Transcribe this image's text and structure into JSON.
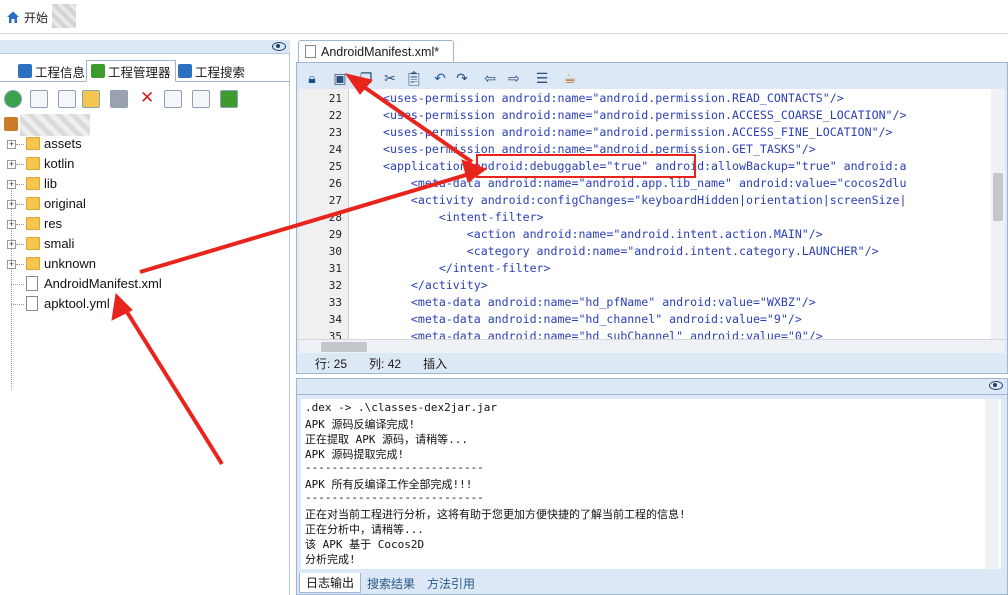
{
  "topbar": {
    "start_label": "开始"
  },
  "left_tabs": [
    {
      "label": "工程信息",
      "color": "#2d6fc1"
    },
    {
      "label": "工程管理器",
      "color": "#3d9a2c"
    },
    {
      "label": "工程搜索",
      "color": "#2d6fc1"
    }
  ],
  "tree": [
    {
      "label": "assets",
      "kind": "folder"
    },
    {
      "label": "kotlin",
      "kind": "folder"
    },
    {
      "label": "lib",
      "kind": "folder"
    },
    {
      "label": "original",
      "kind": "folder"
    },
    {
      "label": "res",
      "kind": "folder"
    },
    {
      "label": "smali",
      "kind": "folder"
    },
    {
      "label": "unknown",
      "kind": "folder"
    },
    {
      "label": "AndroidManifest.xml",
      "kind": "file"
    },
    {
      "label": "apktool.yml",
      "kind": "file"
    }
  ],
  "editor": {
    "tab_label": "AndroidManifest.xml*",
    "line_numbers": [
      "21",
      "22",
      "23",
      "24",
      "25",
      "26",
      "27",
      "28",
      "29",
      "30",
      "31",
      "32",
      "33",
      "34",
      "35"
    ],
    "lines": [
      "<uses-permission android:name=\"android.permission.READ_CONTACTS\"/>",
      "<uses-permission android:name=\"android.permission.ACCESS_COARSE_LOCATION\"/>",
      "<uses-permission android:name=\"android.permission.ACCESS_FINE_LOCATION\"/>",
      "<uses-permission android:name=\"android.permission.GET_TASKS\"/>",
      "<application android:debuggable=\"true\" android:allowBackup=\"true\" android:a",
      "    <meta-data android:name=\"android.app.lib_name\" android:value=\"cocos2dlu",
      "    <activity android:configChanges=\"keyboardHidden|orientation|screenSize|",
      "        <intent-filter>",
      "            <action android:name=\"android.intent.action.MAIN\"/>",
      "            <category android:name=\"android.intent.category.LAUNCHER\"/>",
      "        </intent-filter>",
      "    </activity>",
      "    <meta-data android:name=\"hd_pfName\" android:value=\"WXBZ\"/>",
      "    <meta-data android:name=\"hd_channel\" android:value=\"9\"/>",
      "    <meta-data android:name=\"hd_subChannel\" android:value=\"0\"/>"
    ],
    "status": {
      "row": "行: 25",
      "col": "列: 42",
      "mode": "插入"
    }
  },
  "log": {
    "lines": [
      ".dex -> .\\classes-dex2jar.jar",
      "APK 源码反编译完成!",
      "正在提取 APK 源码，请稍等...",
      "APK 源码提取完成!",
      "---------------------------",
      "APK 所有反编译工作全部完成!!!",
      "---------------------------",
      "正在对当前工程进行分析，这将有助于您更加方便快捷的了解当前工程的信息!",
      "正在分析中，请稍等...",
      "该 APK 基于 Cocos2D",
      "分析完成!"
    ],
    "tabs": [
      "日志输出",
      "搜索结果",
      "方法引用"
    ]
  },
  "colors": {
    "annotation_red": "#e8251d",
    "panel_blue": "#dce8f6",
    "tag_blue": "#2a3fb8"
  }
}
